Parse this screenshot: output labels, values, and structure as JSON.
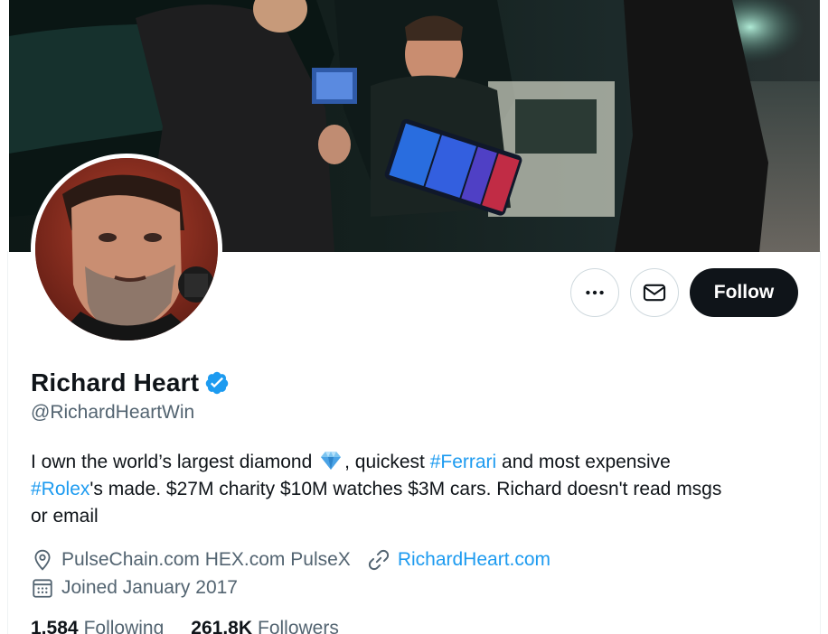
{
  "profile": {
    "name": "Richard Heart",
    "handle": "@RichardHeartWin",
    "bio": {
      "line1_a": "I own the world’s largest diamond",
      "line1_b": ", quickest",
      "hashtag_ferrari": "#Ferrari",
      "line1_c": "and most expensive",
      "hashtag_rolex": "#Rolex",
      "line2": "'s made. $27M charity $10M watches $3M cars. Richard doesn't read msgs",
      "line3": "or email"
    },
    "location": "PulseChain.com HEX.com PulseX",
    "website": "RichardHeart.com",
    "joined": "Joined January 2017",
    "following_count": "1,584",
    "following_label": "Following",
    "followers_count": "261.8K",
    "followers_label": "Followers"
  },
  "actions": {
    "more_icon": "more-dots-icon",
    "message_icon": "envelope-icon",
    "follow_label": "Follow"
  },
  "colors": {
    "link": "#1d9bf0",
    "verified": "#1d9bf0",
    "muted": "#536471",
    "follow_bg": "#0f1419"
  }
}
